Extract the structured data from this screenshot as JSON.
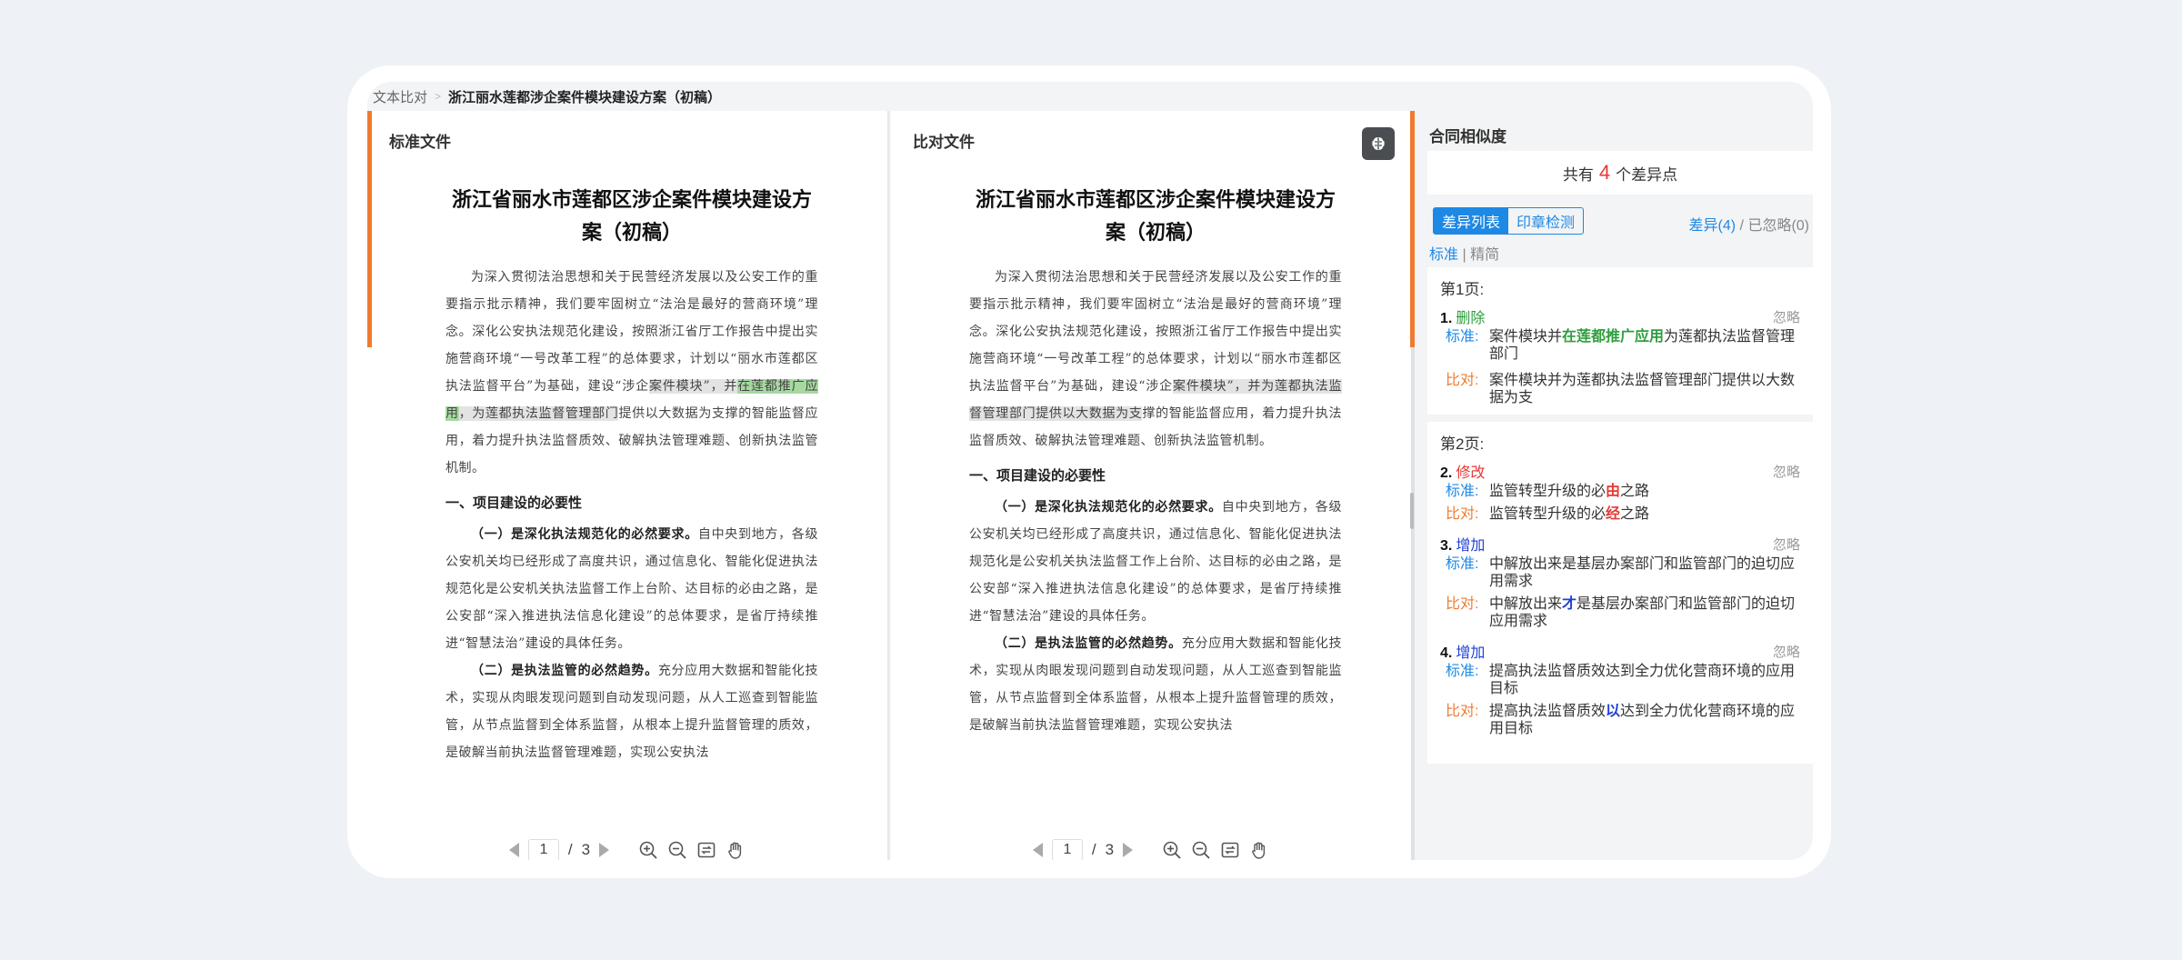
{
  "breadcrumb": {
    "parent": "文本比对",
    "current": "浙江丽水莲都涉企案件模块建设方案（初稿）"
  },
  "standard_panel": {
    "title": "标准文件",
    "doc_title_line1": "浙江省丽水市莲都区涉企案件模块建设方",
    "doc_title_line2": "案（初稿）",
    "p1_a": "为深入贯彻法治思想和关于民营经济发展以及公安工作的重要指示批示精神，我们要牢固树立“法治是最好的营商环境”理念。深化公安执法规范化建设，按照浙江省厅工作报告中提出实施营商环境“一号改革工程”的总体要求，计划以“丽水市莲都区执法监督平台”为基础，建设“涉企",
    "p1_hl_a": "案件模块”，并",
    "p1_hl_green": "在莲都推广应用",
    "p1_hl_b": "，为莲都执法监督管理部门",
    "p1_b": "提供以大数据为支撑的智能监督应用，着力提升执法监督质效、破解执法管理难题、创新执法监管机制。",
    "h1": "一、项目建设的必要性",
    "p2_bold": "（一）是深化执法规范化的必然要求。",
    "p2": "自中央到地方，各级公安机关均已经形成了高度共识，通过信息化、智能化促进执法规范化是公安机关执法监督工作上台阶、达目标的必由之路，是公安部“深入推进执法信息化建设”的总体要求，是省厅持续推进“智慧法治”建设的具体任务。",
    "p3_bold": "（二）是执法监管的必然趋势。",
    "p3": "充分应用大数据和智能化技术，实现从肉眼发现问题到自动发现问题，从人工巡查到智能监管，从节点监督到全体系监督，从根本上提升监督管理的质效，是破解当前执法监督管理难题，实现公安执法"
  },
  "compare_panel": {
    "title": "比对文件",
    "doc_title_line1": "浙江省丽水市莲都区涉企案件模块建设方",
    "doc_title_line2": "案（初稿）",
    "p1_a": "为深入贯彻法治思想和关于民营经济发展以及公安工作的重要指示批示精神，我们要牢固树立“法治是最好的营商环境”理念。深化公安执法规范化建设，按照浙江省厅工作报告中提出实施营商环境“一号改革工程”的总体要求，计划以“丽水市莲都区执法监督平台”为基础，建设“涉企",
    "p1_hl": "案件模块”，并为莲都执法监督管理部门提供以大数据为支",
    "p1_b": "撑的智能监督应用，着力提升执法监督质效、破解执法管理难题、创新执法监管机制。",
    "h1": "一、项目建设的必要性",
    "p2_bold": "（一）是深化执法规范化的必然要求。",
    "p2": "自中央到地方，各级公安机关均已经形成了高度共识，通过信息化、智能化促进执法规范化是公安机关执法监督工作上台阶、达目标的必由之路，是公安部“深入推进执法信息化建设”的总体要求，是省厅持续推进“智慧法治”建设的具体任务。",
    "p3_bold": "（二）是执法监管的必然趋势。",
    "p3": "充分应用大数据和智能化技术，实现从肉眼发现问题到自动发现问题，从人工巡查到智能监管，从节点监督到全体系监督，从根本上提升监督管理的质效，是破解当前执法监督管理难题，实现公安执法"
  },
  "pager": {
    "current": "1",
    "sep": "/",
    "total": "3"
  },
  "side": {
    "title": "合同相似度",
    "summary_pre": "共有",
    "summary_num": "4",
    "summary_post": "个差异点",
    "tab_diff": "差异列表",
    "tab_seal": "印章检测",
    "count_diff": "差异(4)",
    "count_sep": "/",
    "count_ignored": "已忽略(0)",
    "mode_std": "标准",
    "mode_sep": "|",
    "mode_simple": "精简",
    "page1": "第1页:",
    "page2": "第2页:",
    "ignore": "忽略",
    "label_std": "标准:",
    "label_cmp": "比对:",
    "d1": {
      "idx": "1.",
      "type": "删除",
      "std_a": "案件模块并",
      "std_mark": "在莲都推广应用",
      "std_b": "为莲都执法监督管理部门",
      "cmp": "案件模块并为莲都执法监督管理部门提供以大数据为支"
    },
    "d2": {
      "idx": "2.",
      "type": "修改",
      "std_a": "监管转型升级的必",
      "std_mark": "由",
      "std_b": "之路",
      "cmp_a": "监管转型升级的必",
      "cmp_mark": "经",
      "cmp_b": "之路"
    },
    "d3": {
      "idx": "3.",
      "type": "增加",
      "std": "中解放出来是基层办案部门和监管部门的迫切应用需求",
      "cmp_a": "中解放出来",
      "cmp_mark": "才",
      "cmp_b": "是基层办案部门和监管部门的迫切应用需求"
    },
    "d4": {
      "idx": "4.",
      "type": "增加",
      "std": "提高执法监督质效达到全力优化营商环境的应用目标",
      "cmp_a": "提高执法监督质效",
      "cmp_mark": "以",
      "cmp_b": "达到全力优化营商环境的应用目标"
    }
  }
}
